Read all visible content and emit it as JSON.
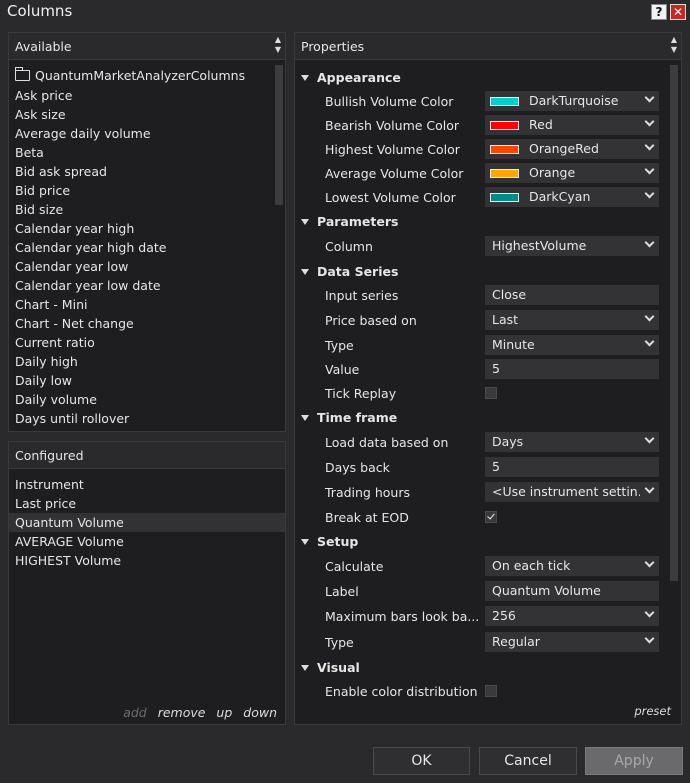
{
  "window": {
    "title": "Columns",
    "help_label": "?",
    "close_label": "✕"
  },
  "available": {
    "header": "Available",
    "folder": "QuantumMarketAnalyzerColumns",
    "items": [
      "Ask price",
      "Ask size",
      "Average daily volume",
      "Beta",
      "Bid ask spread",
      "Bid price",
      "Bid size",
      "Calendar year high",
      "Calendar year high date",
      "Calendar year low",
      "Calendar year low date",
      "Chart - Mini",
      "Chart - Net change",
      "Current ratio",
      "Daily high",
      "Daily low",
      "Daily volume",
      "Days until rollover"
    ]
  },
  "configured": {
    "header": "Configured",
    "items": [
      "Instrument",
      "Last price",
      "Quantum Volume",
      "AVERAGE Volume",
      "HIGHEST Volume"
    ],
    "selected_index": 2,
    "actions": {
      "add": "add",
      "remove": "remove",
      "up": "up",
      "down": "down"
    }
  },
  "properties": {
    "header": "Properties",
    "preset": "preset",
    "categories": {
      "appearance": "Appearance",
      "parameters": "Parameters",
      "data_series": "Data Series",
      "time_frame": "Time frame",
      "setup": "Setup",
      "visual": "Visual"
    },
    "appearance": [
      {
        "label": "Bullish Volume Color",
        "value": "DarkTurquoise",
        "color": "#00CED1"
      },
      {
        "label": "Bearish Volume Color",
        "value": "Red",
        "color": "#FF0000"
      },
      {
        "label": "Highest Volume Color",
        "value": "OrangeRed",
        "color": "#FF4500"
      },
      {
        "label": "Average Volume Color",
        "value": "Orange",
        "color": "#FFA500"
      },
      {
        "label": "Lowest Volume Color",
        "value": "DarkCyan",
        "color": "#008B8B"
      }
    ],
    "parameters": {
      "column_label": "Column",
      "column_value": "HighestVolume"
    },
    "data_series": {
      "input_series_label": "Input series",
      "input_series_value": "Close",
      "price_based_on_label": "Price based on",
      "price_based_on_value": "Last",
      "type_label": "Type",
      "type_value": "Minute",
      "value_label": "Value",
      "value_value": "5",
      "tick_replay_label": "Tick Replay",
      "tick_replay_checked": false
    },
    "time_frame": {
      "load_label": "Load data based on",
      "load_value": "Days",
      "days_back_label": "Days back",
      "days_back_value": "5",
      "trading_hours_label": "Trading hours",
      "trading_hours_value": "<Use instrument settin...",
      "break_eod_label": "Break at EOD",
      "break_eod_checked": true
    },
    "setup": {
      "calculate_label": "Calculate",
      "calculate_value": "On each tick",
      "label_label": "Label",
      "label_value": "Quantum Volume",
      "max_bars_label": "Maximum bars look ba...",
      "max_bars_value": "256",
      "type_label": "Type",
      "type_value": "Regular"
    },
    "visual": {
      "enable_color_label": "Enable color distribution",
      "enable_color_checked": false
    }
  },
  "footer": {
    "ok": "OK",
    "cancel": "Cancel",
    "apply": "Apply"
  }
}
